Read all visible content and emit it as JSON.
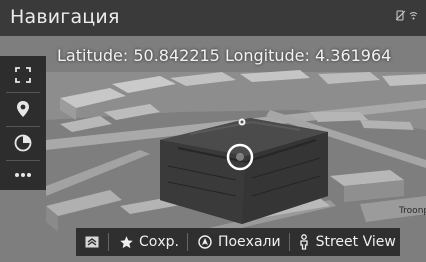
{
  "header": {
    "title": "Навигация"
  },
  "map": {
    "coordinates_text": "Latitude: 50.842215 Longitude: 4.361964",
    "poi_label": "Troonp"
  },
  "sidebar": {
    "items": [
      {
        "icon": "fullscreen-icon"
      },
      {
        "icon": "location-pin-icon"
      },
      {
        "icon": "compass-icon"
      },
      {
        "icon": "more-icon"
      }
    ]
  },
  "actions": {
    "collapse_icon": "chevron-up-icon",
    "save_label": "Сохр.",
    "go_label": "Поехали",
    "streetview_label": "Street View"
  },
  "colors": {
    "header_bg": "#3a3a3a",
    "toolbar_bg": "#2d2d2d",
    "building_dark": "#3b3b3b",
    "map_bg": "#7e7e7e"
  }
}
